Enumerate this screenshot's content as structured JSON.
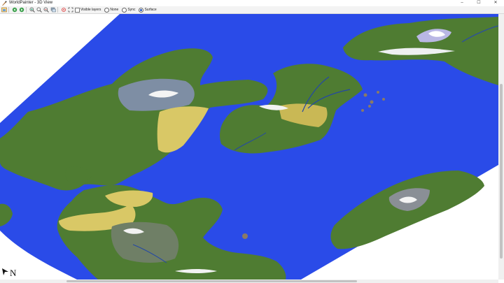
{
  "window": {
    "title": "WorldPainter - 3D View",
    "controls": {
      "minimize": "–",
      "maximize": "☐",
      "close": "✕"
    }
  },
  "toolbar": {
    "visible_layers_label": "Visible layers",
    "radios": [
      {
        "label": "None",
        "selected": false
      },
      {
        "label": "Sync",
        "selected": false
      },
      {
        "label": "Surface",
        "selected": true
      }
    ]
  },
  "compass": {
    "label": "N"
  },
  "colors": {
    "water": "#2a4be8",
    "land": "#4e7a30",
    "sand": "#d8c76a",
    "snow": "#f0f0f0",
    "rock": "#8a8f96"
  }
}
